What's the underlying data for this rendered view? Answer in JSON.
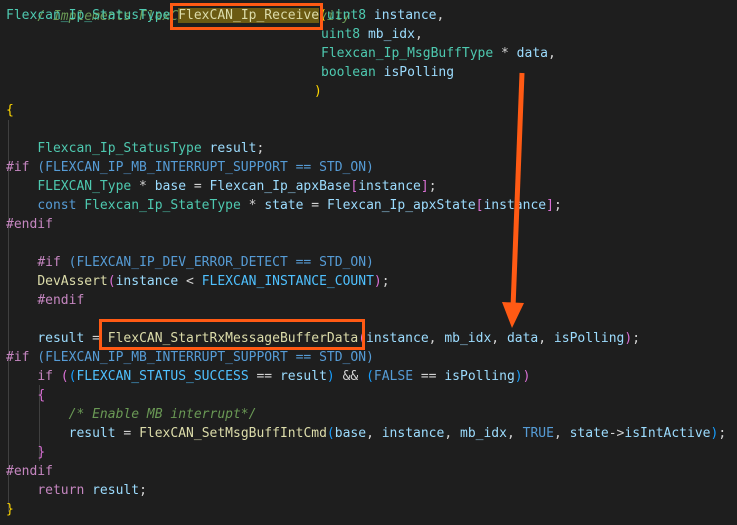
{
  "code": {
    "line0_comment": "/ Implements FlexCAN Ip Receive Activity",
    "l1_type": "Flexcan_Ip_StatusType",
    "l1_func": "FlexCAN_Ip_Receive",
    "l1_open": "(",
    "l1_ptype": "uint8",
    "l1_pname": "instance",
    "l1_comma": ",",
    "l2_ptype": "uint8",
    "l2_pname": "mb_idx",
    "l3_ptype": "Flexcan_Ip_MsgBuffType",
    "l3_star": " * ",
    "l3_pname": "data",
    "l4_ptype": "boolean",
    "l4_pname": "isPolling",
    "l5_close": ")",
    "l6_brace": "{",
    "l8_type": "Flexcan_Ip_StatusType",
    "l8_var": "result",
    "l8_semi": ";",
    "l9_pp": "#if",
    "l9_rest": " (FLEXCAN_IP_MB_INTERRUPT_SUPPORT == STD_ON)",
    "l10_type": "FLEXCAN_Type",
    "l10_star": " * ",
    "l10_var": "base",
    "l10_eq": " = ",
    "l10_arr": "Flexcan_Ip_apxBase",
    "l10_ob": "[",
    "l10_idx": "instance",
    "l10_cb": "]",
    "l10_semi": ";",
    "l11_kw": "const",
    "l11_type": "Flexcan_Ip_StateType",
    "l11_star": " * ",
    "l11_var": "state",
    "l11_eq": " = ",
    "l11_arr": "Flexcan_Ip_apxState",
    "l11_ob": "[",
    "l11_idx": "instance",
    "l11_cb": "]",
    "l11_semi": ";",
    "l12_pp": "#endif",
    "l14_pp": "#if",
    "l14_rest": " (FLEXCAN_IP_DEV_ERROR_DETECT == STD_ON)",
    "l15_func": "DevAssert",
    "l15_open": "(",
    "l15_var": "instance",
    "l15_lt": " < ",
    "l15_mac": "FLEXCAN_INSTANCE_COUNT",
    "l15_close": ")",
    "l15_semi": ";",
    "l16_pp": "#endif",
    "l18_var": "result",
    "l18_eq": " = ",
    "l18_func": "FlexCAN_StartRxMessageBufferData",
    "l18_open": "(",
    "l18_a1": "instance",
    "l18_c1": ", ",
    "l18_a2": "mb_idx",
    "l18_c2": ", ",
    "l18_a3": "data",
    "l18_c3": ", ",
    "l18_a4": "isPolling",
    "l18_close": ")",
    "l18_semi": ";",
    "l19_pp": "#if",
    "l19_rest": " (FLEXCAN_IP_MB_INTERRUPT_SUPPORT == STD_ON)",
    "l20_kw": "if",
    "l20_o1": " (",
    "l20_o2": "(",
    "l20_mac": "FLEXCAN_STATUS_SUCCESS",
    "l20_eq": " == ",
    "l20_var": "result",
    "l20_c2": ")",
    "l20_and": " && ",
    "l20_o3": "(",
    "l20_false": "FALSE",
    "l20_eq2": " == ",
    "l20_var2": "isPolling",
    "l20_c3": ")",
    "l20_c1": ")",
    "l21_brace": "{",
    "l22_comment": "/* Enable MB interrupt*/",
    "l23_var": "result",
    "l23_eq": " = ",
    "l23_func": "FlexCAN_SetMsgBuffIntCmd",
    "l23_open": "(",
    "l23_a1": "base",
    "l23_c1": ", ",
    "l23_a2": "instance",
    "l23_c2": ", ",
    "l23_a3": "mb_idx",
    "l23_c3": ", ",
    "l23_true": "TRUE",
    "l23_c4": ", ",
    "l23_a5": "state",
    "l23_arrow": "->",
    "l23_a6": "isIntActive",
    "l23_close": ")",
    "l23_semi": ";",
    "l24_brace": "}",
    "l25_pp": "#endif",
    "l26_kw": "return",
    "l26_var": "result",
    "l26_semi": ";",
    "l27_brace": "}"
  },
  "annotation": {
    "color": "#ff5a14"
  }
}
